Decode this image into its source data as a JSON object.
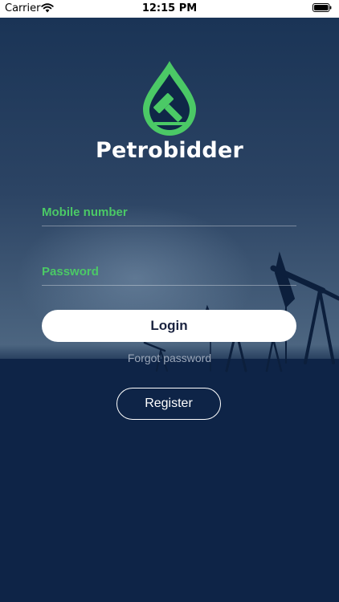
{
  "status_bar": {
    "carrier": "Carrier",
    "time": "12:15 PM"
  },
  "brand": {
    "name": "Petrobidder",
    "logo_icon": "oil-drop-gavel-icon"
  },
  "form": {
    "mobile_label": "Mobile number",
    "password_label": "Password",
    "login_label": "Login",
    "forgot_label": "Forgot password",
    "register_label": "Register"
  },
  "colors": {
    "background": "#0f2747",
    "accent": "#4bc966",
    "button_text": "#1b2440"
  }
}
